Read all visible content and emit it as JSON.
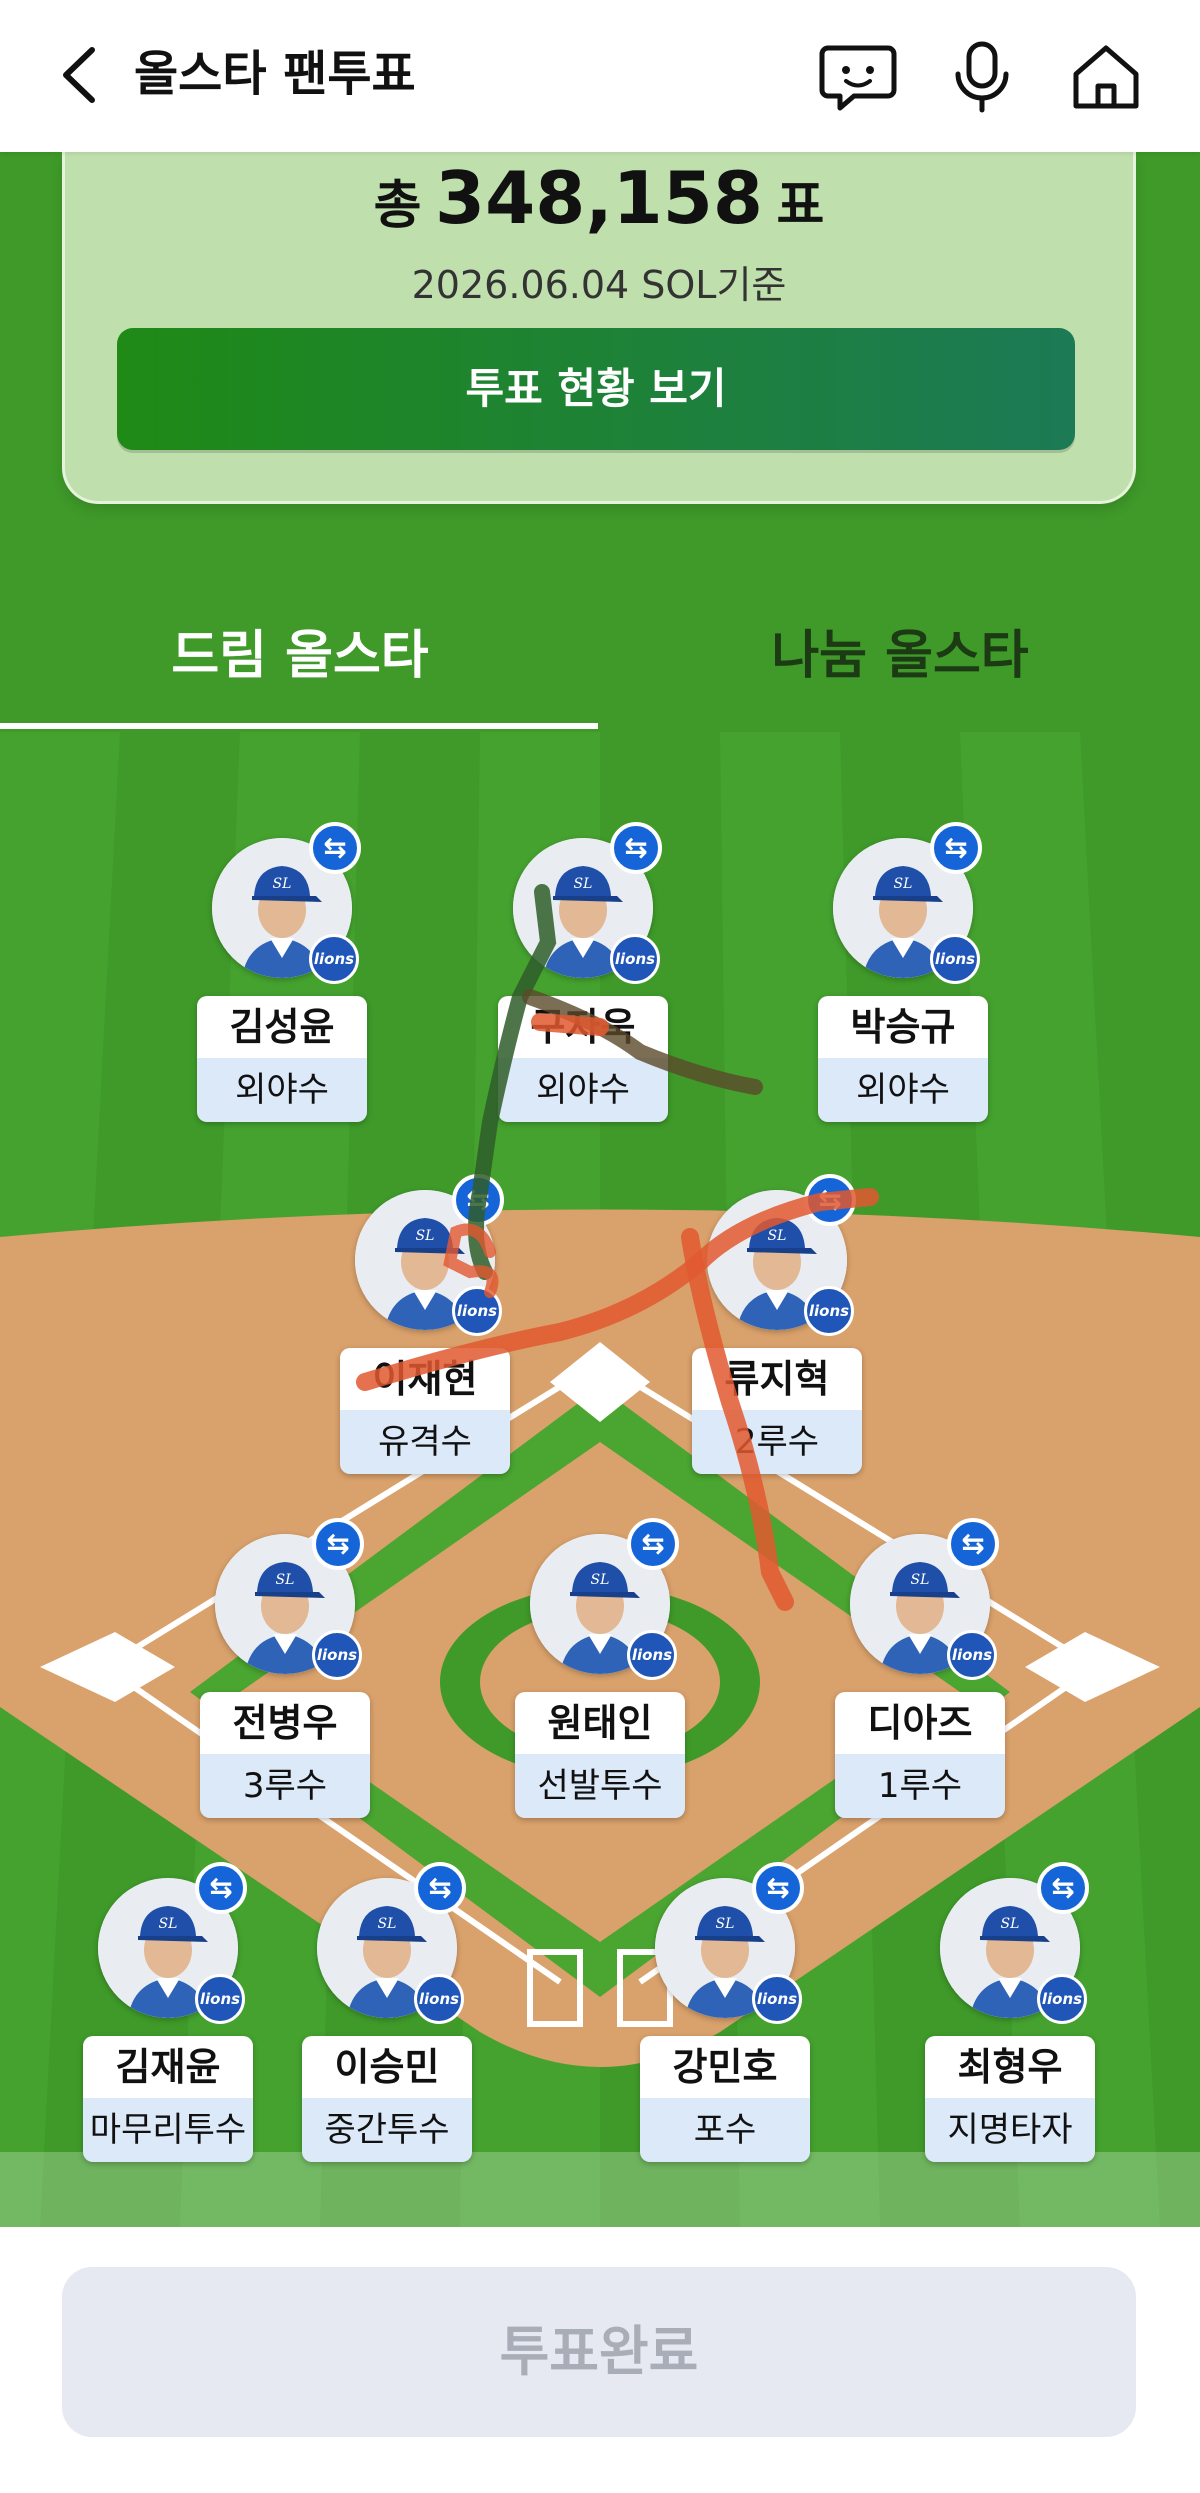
{
  "header": {
    "title": "올스타 팬투표",
    "back_icon": "chevron-left-icon",
    "chat_icon": "chat-bot-icon",
    "mic_icon": "microphone-icon",
    "home_icon": "home-icon"
  },
  "summary": {
    "total_prefix": "총",
    "total_votes": "348,158",
    "total_suffix": "표",
    "date_text": "2026.06.04 SOL기준",
    "status_button": "투표 현황 보기"
  },
  "tabs": [
    {
      "label": "드림 올스타",
      "active": true
    },
    {
      "label": "나눔 올스타",
      "active": false
    }
  ],
  "players": [
    {
      "name": "김성윤",
      "position": "외야수"
    },
    {
      "name": "구자욱",
      "position": "외야수"
    },
    {
      "name": "박승규",
      "position": "외야수"
    },
    {
      "name": "이재현",
      "position": "유격수"
    },
    {
      "name": "류지혁",
      "position": "2루수"
    },
    {
      "name": "전병우",
      "position": "3루수"
    },
    {
      "name": "원태인",
      "position": "선발투수"
    },
    {
      "name": "디아즈",
      "position": "1루수"
    },
    {
      "name": "김재윤",
      "position": "마무리투수"
    },
    {
      "name": "이승민",
      "position": "중간투수"
    },
    {
      "name": "강민호",
      "position": "포수"
    },
    {
      "name": "최형우",
      "position": "지명타자"
    }
  ],
  "icons": {
    "swap": "swap-icon",
    "team_badge": "lions-badge-icon"
  },
  "team_badge_text": "lions",
  "colors": {
    "accent_blue": "#1565d8",
    "button_green": "#1f8a16",
    "grass": "#3f9a29",
    "dirt": "#d9a16b"
  },
  "bottom": {
    "complete_button": "투표완료"
  }
}
